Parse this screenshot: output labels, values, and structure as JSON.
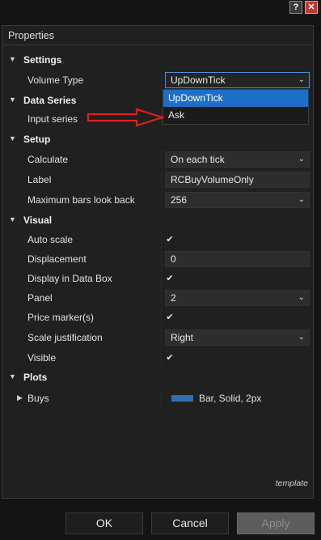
{
  "window": {
    "help_glyph": "?",
    "close_glyph": "✕"
  },
  "panel": {
    "title": "Properties"
  },
  "sections": {
    "settings": "Settings",
    "data_series": "Data Series",
    "setup": "Setup",
    "visual": "Visual",
    "plots": "Plots"
  },
  "props": {
    "volume_type": {
      "label": "Volume Type",
      "value": "UpDownTick"
    },
    "input_series": {
      "label": "Input series"
    },
    "calculate": {
      "label": "Calculate",
      "value": "On each tick"
    },
    "label": {
      "label": "Label",
      "value": "RCBuyVolumeOnly"
    },
    "max_bars": {
      "label": "Maximum bars look back",
      "value": "256"
    },
    "auto_scale": {
      "label": "Auto scale",
      "checked": true
    },
    "displacement": {
      "label": "Displacement",
      "value": "0"
    },
    "display_in_data_box": {
      "label": "Display in Data Box",
      "checked": true
    },
    "panel": {
      "label": "Panel",
      "value": "2"
    },
    "price_marker": {
      "label": "Price marker(s)",
      "checked": true
    },
    "scale_justification": {
      "label": "Scale justification",
      "value": "Right"
    },
    "visible": {
      "label": "Visible",
      "checked": true
    }
  },
  "dropdown": {
    "options": [
      "UpDownTick",
      "Ask"
    ],
    "selected_index": 0
  },
  "plots": {
    "buys": {
      "label": "Buys",
      "style": "Bar, Solid, 2px",
      "color": "#2e6fb0"
    }
  },
  "template_link": "template",
  "buttons": {
    "ok": "OK",
    "cancel": "Cancel",
    "apply": "Apply"
  },
  "colors": {
    "accent": "#1f6fc8",
    "annotation_arrow": "#e0201a"
  }
}
